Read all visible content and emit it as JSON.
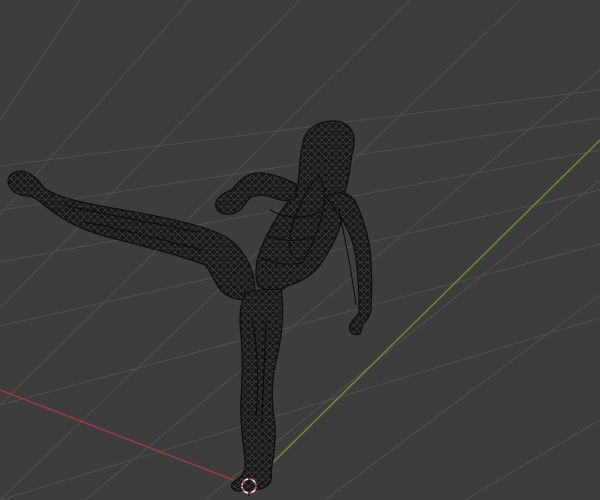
{
  "viewport": {
    "mode": "3d-viewport",
    "shading": "wireframe",
    "background_color": "#3d3d3d",
    "grid_color": "#4f4f4f",
    "x_axis_color": "#9b3b45",
    "y_axis_color": "#6e8b36",
    "mesh_color": "#151515",
    "mesh_wire_color": "#4a4a4a",
    "cursor_icon": "3d-cursor-icon",
    "object": {
      "type": "human-figure-mesh",
      "pose": "high-side-kick"
    }
  }
}
